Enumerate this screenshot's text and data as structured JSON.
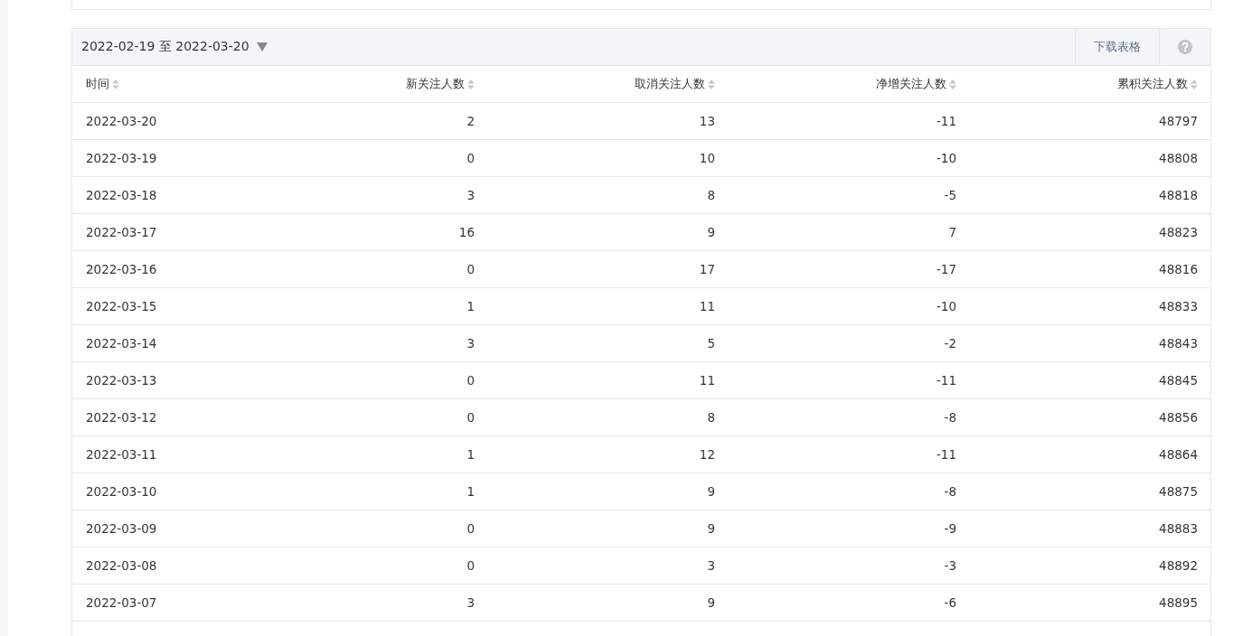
{
  "date_range": {
    "label": "2022-02-19 至 2022-03-20"
  },
  "toolbar": {
    "download_label": "下载表格"
  },
  "table": {
    "columns": [
      {
        "label": "时间",
        "kind": "date"
      },
      {
        "label": "新关注人数",
        "kind": "number"
      },
      {
        "label": "取消关注人数",
        "kind": "number"
      },
      {
        "label": "净增关注人数",
        "kind": "number"
      },
      {
        "label": "累积关注人数",
        "kind": "number"
      }
    ],
    "rows": [
      [
        "2022-03-20",
        "2",
        "13",
        "-11",
        "48797"
      ],
      [
        "2022-03-19",
        "0",
        "10",
        "-10",
        "48808"
      ],
      [
        "2022-03-18",
        "3",
        "8",
        "-5",
        "48818"
      ],
      [
        "2022-03-17",
        "16",
        "9",
        "7",
        "48823"
      ],
      [
        "2022-03-16",
        "0",
        "17",
        "-17",
        "48816"
      ],
      [
        "2022-03-15",
        "1",
        "11",
        "-10",
        "48833"
      ],
      [
        "2022-03-14",
        "3",
        "5",
        "-2",
        "48843"
      ],
      [
        "2022-03-13",
        "0",
        "11",
        "-11",
        "48845"
      ],
      [
        "2022-03-12",
        "0",
        "8",
        "-8",
        "48856"
      ],
      [
        "2022-03-11",
        "1",
        "12",
        "-11",
        "48864"
      ],
      [
        "2022-03-10",
        "1",
        "9",
        "-8",
        "48875"
      ],
      [
        "2022-03-09",
        "0",
        "9",
        "-9",
        "48883"
      ],
      [
        "2022-03-08",
        "0",
        "3",
        "-3",
        "48892"
      ],
      [
        "2022-03-07",
        "3",
        "9",
        "-6",
        "48895"
      ]
    ]
  }
}
